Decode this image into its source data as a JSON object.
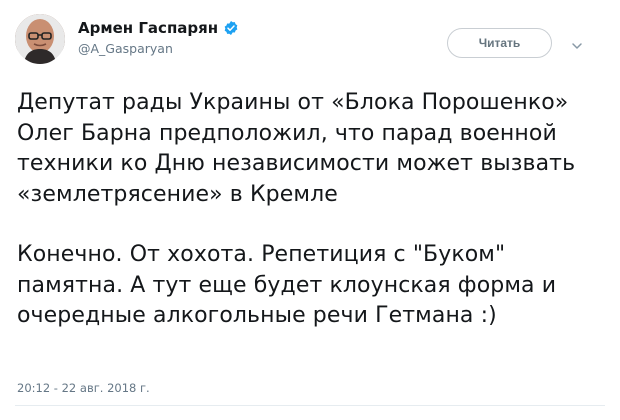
{
  "author": {
    "name": "Армен Гаспарян",
    "handle": "@A_Gasparyan",
    "verified_icon": "verified-badge-icon",
    "verified_color": "#1da1f2"
  },
  "actions": {
    "follow_label": "Читать",
    "menu_icon": "chevron-down-icon"
  },
  "tweet": {
    "paragraphs": [
      "Депутат рады Украины от «Блока Порошенко» Олег Барна предположил, что парад военной техники ко Дню независимости может вызвать «землетрясение» в Кремле",
      "Конечно. От хохота. Репетиция с \"Буком\" памятна. А тут еще будет клоунская форма и очередные алкогольные речи Гетмана :)"
    ],
    "timestamp": "20:12 - 22 авг. 2018 г."
  }
}
